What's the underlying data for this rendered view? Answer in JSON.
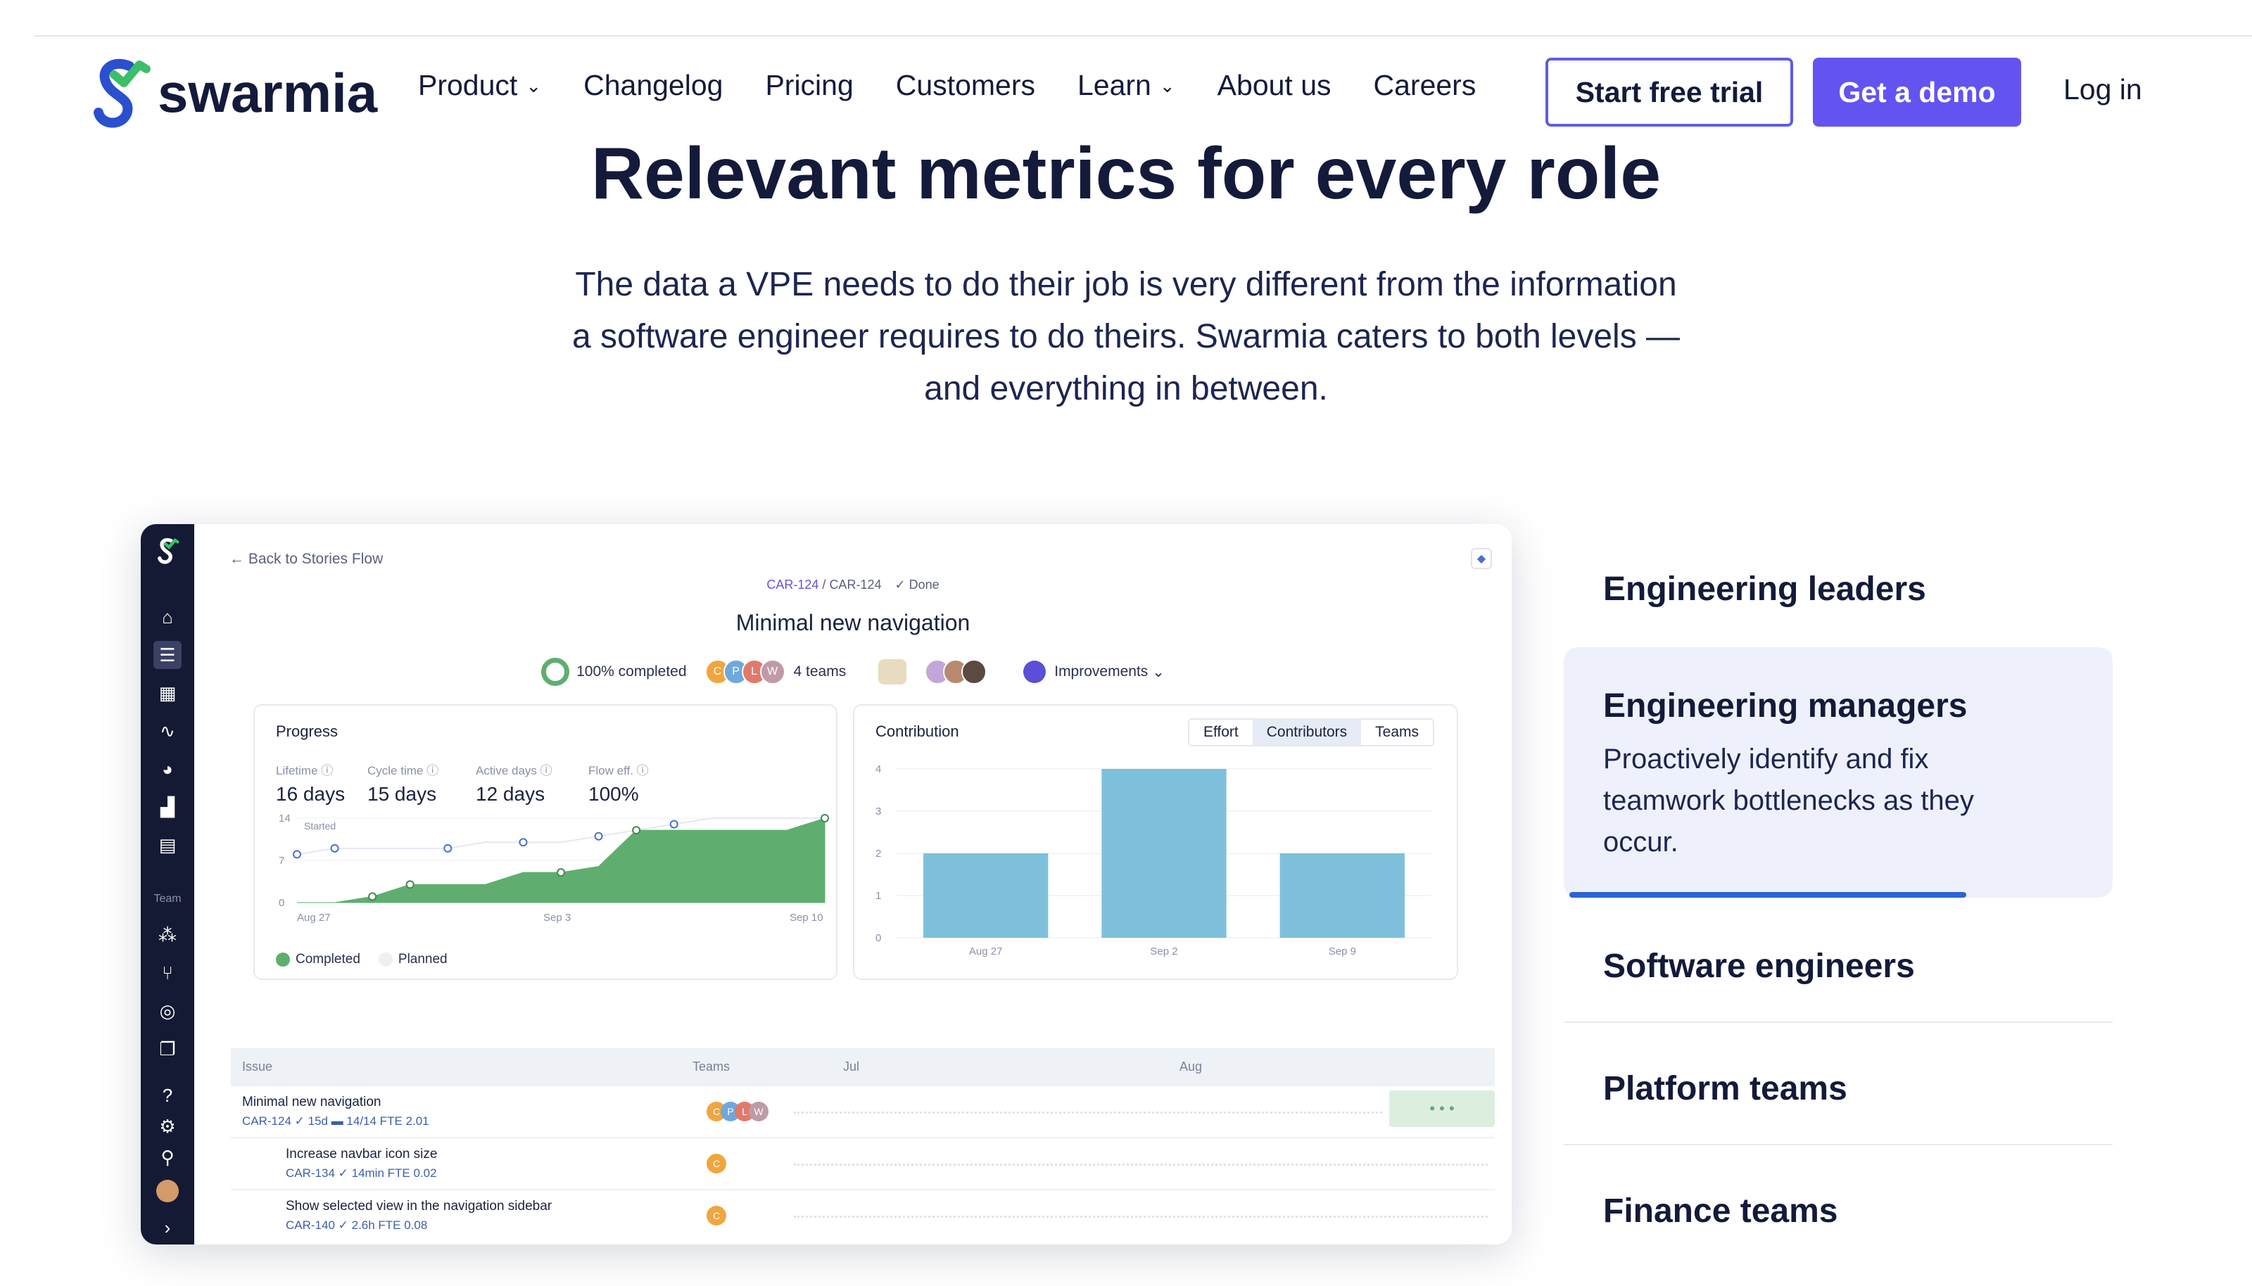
{
  "brand": {
    "name": "swarmia",
    "accent": "#6354f2",
    "dark": "#141a3a"
  },
  "nav": {
    "links": [
      {
        "label": "Product",
        "has_dropdown": true
      },
      {
        "label": "Changelog",
        "has_dropdown": false
      },
      {
        "label": "Pricing",
        "has_dropdown": false
      },
      {
        "label": "Customers",
        "has_dropdown": false
      },
      {
        "label": "Learn",
        "has_dropdown": true
      },
      {
        "label": "About us",
        "has_dropdown": false
      },
      {
        "label": "Careers",
        "has_dropdown": false
      }
    ],
    "trial_label": "Start free trial",
    "demo_label": "Get a demo",
    "login_label": "Log in"
  },
  "hero": {
    "title": "Relevant metrics for every role",
    "subtitle": "The data a VPE needs to do their job is very different from the information a software engineer requires to do theirs. Swarmia caters to both levels — and everything in between."
  },
  "app": {
    "back_link": "← Back to Stories Flow",
    "crumb_1": "CAR-124",
    "crumb_2": "CAR-124",
    "crumb_status": "✓ Done",
    "story_title": "Minimal new navigation",
    "completed": "100% completed",
    "teams_count": "4 teams",
    "category": "Improvements",
    "sidebar_team_label": "Team",
    "progress": {
      "title": "Progress",
      "stats": [
        {
          "label": "Lifetime ⓘ",
          "value": "16 days"
        },
        {
          "label": "Cycle time ⓘ",
          "value": "15 days"
        },
        {
          "label": "Active days ⓘ",
          "value": "12 days"
        },
        {
          "label": "Flow eff. ⓘ",
          "value": "100%"
        }
      ],
      "y_ticks": [
        "14",
        "7",
        "0"
      ],
      "x_ticks": [
        "Aug 27",
        "Sep 3",
        "Sep 10"
      ],
      "started_label": "Started",
      "legend_completed": "Completed",
      "legend_planned": "Planned"
    },
    "contribution": {
      "title": "Contribution",
      "tabs": [
        "Effort",
        "Contributors",
        "Teams"
      ],
      "active_tab": "Contributors"
    },
    "table": {
      "headers": {
        "issue": "Issue",
        "teams": "Teams",
        "jul": "Jul",
        "aug": "Aug"
      },
      "rows": [
        {
          "name": "Minimal new navigation",
          "sub": "CAR-124  ✓ 15d  ▬ 14/14  FTE 2.01"
        },
        {
          "name": "Increase navbar icon size",
          "sub": "CAR-134  ✓ 14min  FTE 0.02"
        },
        {
          "name": "Show selected view in the navigation sidebar",
          "sub": "CAR-140  ✓ 2.6h  FTE 0.08"
        }
      ]
    }
  },
  "chart_data": [
    {
      "type": "area",
      "title": "Progress",
      "x": [
        "Aug 27",
        "Sep 3",
        "Sep 10"
      ],
      "ylim": [
        0,
        14
      ],
      "series": [
        {
          "name": "Completed",
          "color": "#5fae6f",
          "values": [
            0,
            0,
            1,
            3,
            3,
            3,
            5,
            5,
            6,
            12,
            12,
            12,
            12,
            12,
            14
          ]
        },
        {
          "name": "Planned",
          "color": "#4a6fd1",
          "values": [
            8,
            9,
            9,
            9,
            9,
            10,
            10,
            10,
            11,
            12,
            13,
            14,
            14,
            14,
            14
          ]
        }
      ]
    },
    {
      "type": "bar",
      "title": "Contribution",
      "categories": [
        "Aug 27",
        "Sep 2",
        "Sep 9"
      ],
      "values": [
        2,
        4,
        2
      ],
      "ylim": [
        0,
        4
      ],
      "y_ticks": [
        "4",
        "3",
        "2",
        "1",
        "0"
      ],
      "color": "#7ec0db"
    }
  ],
  "roles": {
    "items": [
      {
        "label": "Engineering leaders"
      },
      {
        "label": "Engineering managers",
        "description": "Proactively identify and fix teamwork bottlenecks as they occur.",
        "active": true,
        "progress": 0.72
      },
      {
        "label": "Software engineers"
      },
      {
        "label": "Platform teams"
      },
      {
        "label": "Finance teams"
      }
    ]
  }
}
